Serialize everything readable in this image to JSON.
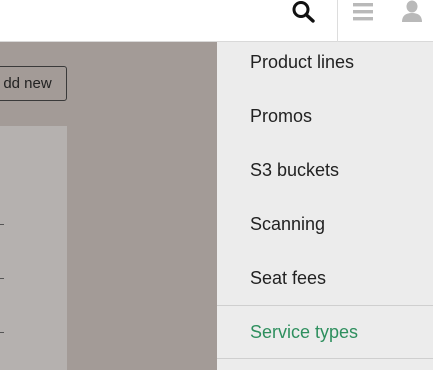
{
  "page": {
    "add_new_label": "dd new"
  },
  "menu": {
    "items": [
      {
        "label": "Product lines"
      },
      {
        "label": "Promos"
      },
      {
        "label": "S3 buckets"
      },
      {
        "label": "Scanning"
      },
      {
        "label": "Seat fees"
      },
      {
        "label": "Service types"
      }
    ],
    "active_index": 5
  },
  "colors": {
    "active": "#2e8f5e",
    "overlay": "#a39b97",
    "menu_bg": "#ececec"
  },
  "icons": {
    "search": "search-icon",
    "menu": "hamburger-icon",
    "user": "user-icon"
  }
}
